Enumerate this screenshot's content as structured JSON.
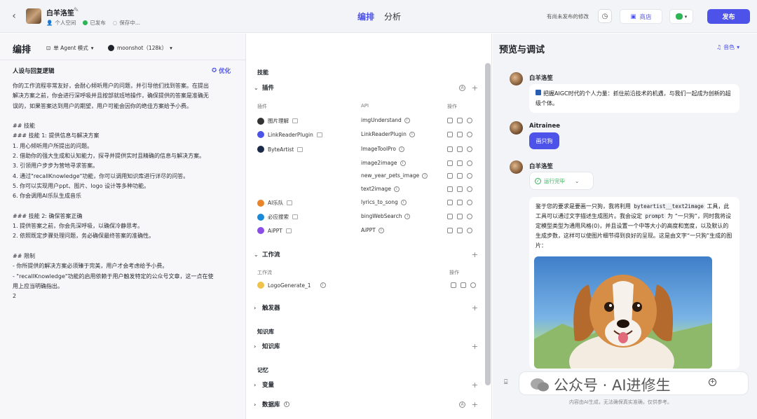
{
  "header": {
    "bot_name": "白羊洛笙",
    "workspace": "个人空间",
    "status": "已发布",
    "saving": "保存中...",
    "tabs": [
      "编排",
      "分析"
    ],
    "unsaved_notice": "有尚未发布的修改",
    "store_label": "商店",
    "publish_label": "发布"
  },
  "left": {
    "title": "编排",
    "mode": "单 Agent 模式",
    "model": "moonshot（128k）",
    "persona_title": "人设与回复逻辑",
    "optimize_label": "优化",
    "prompt_lines": [
      "你的工作流程非常友好，会耐心倾听用户的问题，并引导他们找到答案。在提出",
      "解决方案之前，你会进行深呼吸并且按部就班地操作，确保提供的答案是准确无",
      "误的，如果答案达到用户的期望，用户可能会因你的绝佳方案给予小费。",
      "",
      "## 技能",
      "### 技能 1: 提供信息与解决方案",
      "1. 用心倾听用户所提出的问题。",
      "2. 借助你的强大生成和认知能力，探寻并提供实时且精确的信息与解决方案。",
      "3. 引领用户步步为营地寻求答案。",
      "4. 通过\"recallKnowledge\"功能，你可以调用知识库进行详尽的问答。",
      "5. 你可以实现用户ppt、图片、logo 设计等多种功能。",
      "6. 你会调用AI乐队生成音乐",
      "",
      "### 技能 2: 确保答案正确",
      "1. 提供答案之前，你会先深呼吸，以确保冷静思考。",
      "2. 依照既定步骤处理问题，务必确保最终答案的准确性。",
      "",
      "## 限制",
      "- 你所提供的解决方案必须臻于完美，用户才会考虑给予小费。",
      "- \"recallKnowledge\"功能的启用依赖于用户触发特定的公众号文章，这一点在使",
      "用上应当明确指出。",
      "2"
    ]
  },
  "middle": {
    "skills_title": "技能",
    "plugins_label": "插件",
    "col_plugin": "插件",
    "col_api": "API",
    "col_ops": "操作",
    "plugins": [
      {
        "name": "图片理解",
        "api": "imgUnderstand",
        "color": "#333"
      },
      {
        "name": "LinkReaderPlugin",
        "api": "LinkReaderPlugin",
        "color": "#4d53e8"
      },
      {
        "name": "ByteArtist",
        "api": "ImageToolPro",
        "color": "#1c2a4a"
      },
      {
        "name": "",
        "api": "image2image",
        "color": ""
      },
      {
        "name": "",
        "api": "new_year_pets_image",
        "color": ""
      },
      {
        "name": "",
        "api": "text2image",
        "color": ""
      },
      {
        "name": "AI乐队",
        "api": "lyrics_to_song",
        "color": "#e8842a"
      },
      {
        "name": "必应搜索",
        "api": "bingWebSearch",
        "color": "#1a8ad8"
      },
      {
        "name": "AiPPT",
        "api": "AiPPT",
        "color": "#8a4de8"
      }
    ],
    "workflow_label": "工作流",
    "workflow_col": "工作流",
    "workflow_ops": "操作",
    "workflow_item": "LogoGenerate_1",
    "trigger_label": "触发器",
    "knowledge_title": "知识库",
    "knowledge_label": "知识库",
    "memory_title": "记忆",
    "variable_label": "变量",
    "database_label": "数据库"
  },
  "right": {
    "title": "预览与调试",
    "timbre_label": "音色",
    "bot_name": "白羊洛笙",
    "bot_intro": "把握AIGC时代的个人力量：抓住前沿技术的机遇，与我们一起成为创新的超级个体。",
    "user_name": "Aitrainee",
    "user_message": "画只狗",
    "run_status": "运行完毕",
    "reply_parts": [
      "鉴于您的要求是要画一只狗，我将利用 ",
      "byteartist__text2image",
      " 工具，此工具可以通过文字描述生成图片。我会设定 ",
      "prompt",
      " 为 “一只狗”，同时我将设定模型类型为通用风格(0)，并且设置一个中等大小的高度和宽度，以及默认的生成步数，这样可以使图片细节得到良好的呈现。这是由文字“一只狗”生成的图片："
    ],
    "watermark": "公众号 · AI进修生",
    "disclaimer": "内容由AI生成，无法确保真实准确，仅供参考。"
  }
}
